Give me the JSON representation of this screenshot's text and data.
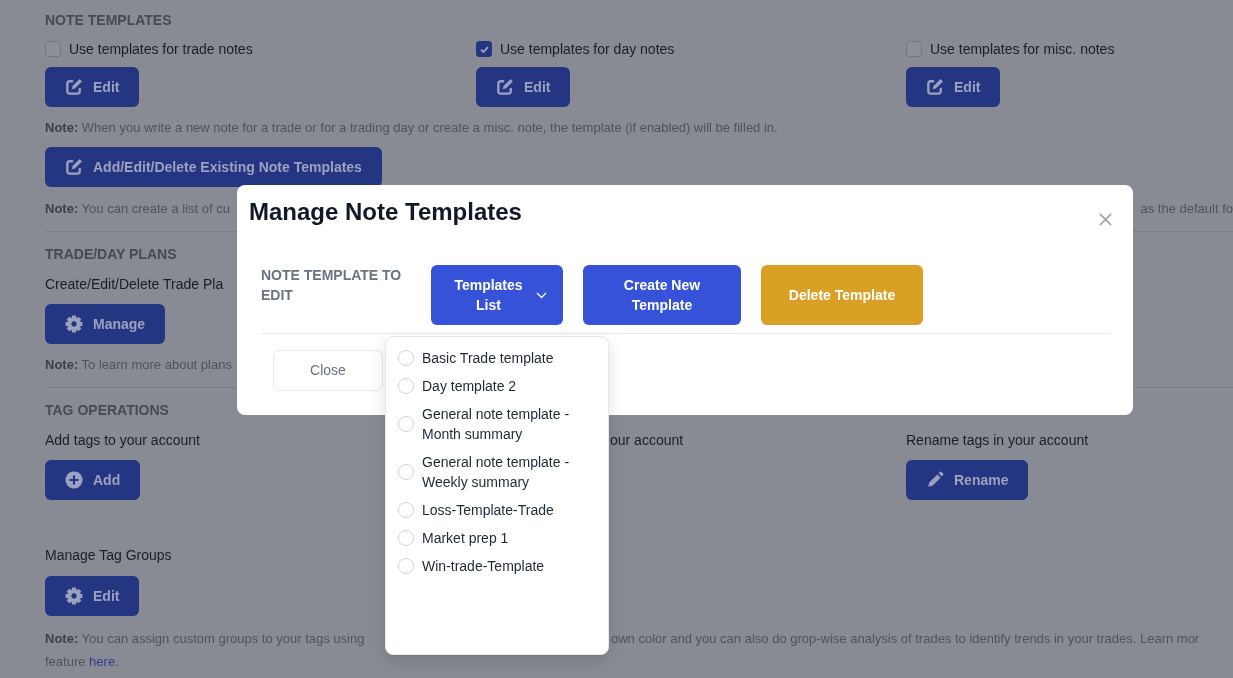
{
  "note_templates": {
    "heading": "NOTE TEMPLATES",
    "options": [
      {
        "label": "Use templates for trade notes",
        "checked": false,
        "button": "Edit"
      },
      {
        "label": "Use templates for day notes",
        "checked": true,
        "button": "Edit"
      },
      {
        "label": "Use templates for misc. notes",
        "checked": false,
        "button": "Edit"
      }
    ],
    "note": "**Note:** When you write a new note for a trade or for a trading day or create a misc. note, the template (if enabled) will be filled in.",
    "manage_button": "Add/Edit/Delete Existing Note Templates",
    "list_note_start": "**Note:** You can create a list of cu",
    "list_note_end": "as the default fo"
  },
  "trade_day_plans": {
    "heading": "TRADE/DAY PLANS",
    "label": "Create/Edit/Delete Trade Pla",
    "button": "Manage",
    "note": "**Note:** To learn more about plans"
  },
  "tag_operations": {
    "heading": "TAG OPERATIONS",
    "actions": [
      {
        "kind": "add",
        "label": "Add tags to your account",
        "button": "Add"
      },
      {
        "kind": "partial",
        "label": "our account"
      },
      {
        "kind": "rename",
        "label": "Rename tags in your account",
        "button": "Rename"
      }
    ],
    "groups": {
      "label": "Manage Tag Groups",
      "button": "Edit",
      "note_start": "**Note:** You can assign custom groups to your tags using",
      "note_end": "own color and you can also do grop-wise analysis of trades to identify trends in your trades. Learn mor",
      "note_tail": {
        "before": "feature",
        "link": "here",
        "after": "."
      }
    }
  },
  "modal": {
    "title": "Manage Note Templates",
    "field_label": "NOTE TEMPLATE TO EDIT",
    "buttons": [
      {
        "kind": "dropdown",
        "label": "Templates List",
        "expanded": true
      },
      {
        "kind": "primary",
        "label": "Create New Template"
      },
      {
        "kind": "warning",
        "label": "Delete Template"
      }
    ],
    "template_options": [
      {
        "label": "Basic Trade template",
        "selected": false
      },
      {
        "label": "Day template 2",
        "selected": false
      },
      {
        "label": "General note template - Month summary",
        "selected": false
      },
      {
        "label": "General note template - Weekly summary",
        "selected": false
      },
      {
        "label": "Loss-Template-Trade",
        "selected": false
      },
      {
        "label": "Market prep 1",
        "selected": false
      },
      {
        "label": "Win-trade-Template",
        "selected": false
      }
    ],
    "close_button": "Close"
  }
}
